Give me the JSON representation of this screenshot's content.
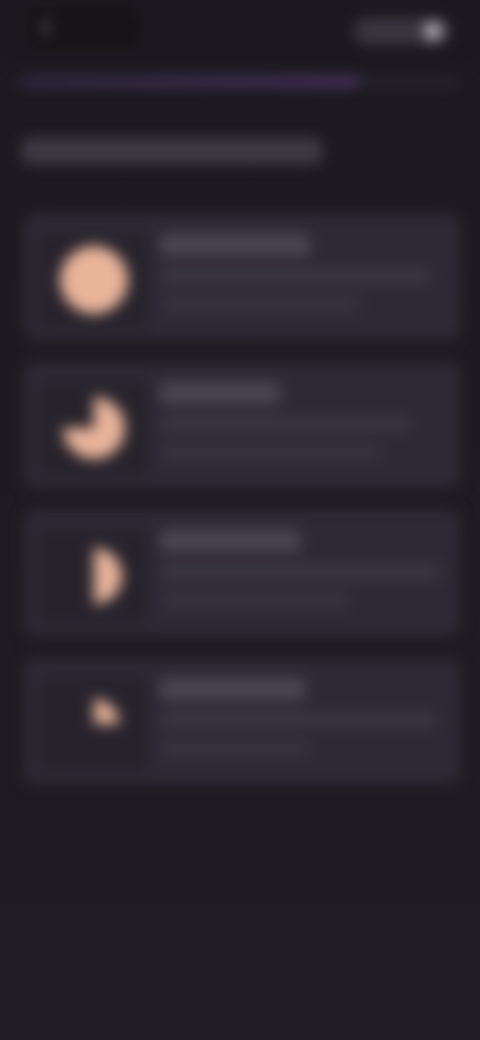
{
  "header": {
    "back_label": "",
    "back_icon": "back-arrow-icon",
    "right_pill_icon": "toggle-knob-icon"
  },
  "progress": {
    "fraction": 0.77,
    "accent": "#5b3a78"
  },
  "page": {
    "title": ""
  },
  "options": [
    {
      "icon": "full-circle-icon",
      "title": "",
      "description": "",
      "description2": "",
      "fill": 1.0
    },
    {
      "icon": "three-quarter-circle-icon",
      "title": "",
      "description": "",
      "description2": "",
      "fill": 0.75
    },
    {
      "icon": "half-circle-icon",
      "title": "",
      "description": "",
      "description2": "",
      "fill": 0.5
    },
    {
      "icon": "quarter-circle-icon",
      "title": "",
      "description": "",
      "description2": "",
      "fill": 0.25
    }
  ],
  "colors": {
    "background": "#1d1a21",
    "card": "#2e2a35",
    "illustration": "#e8b49a"
  }
}
